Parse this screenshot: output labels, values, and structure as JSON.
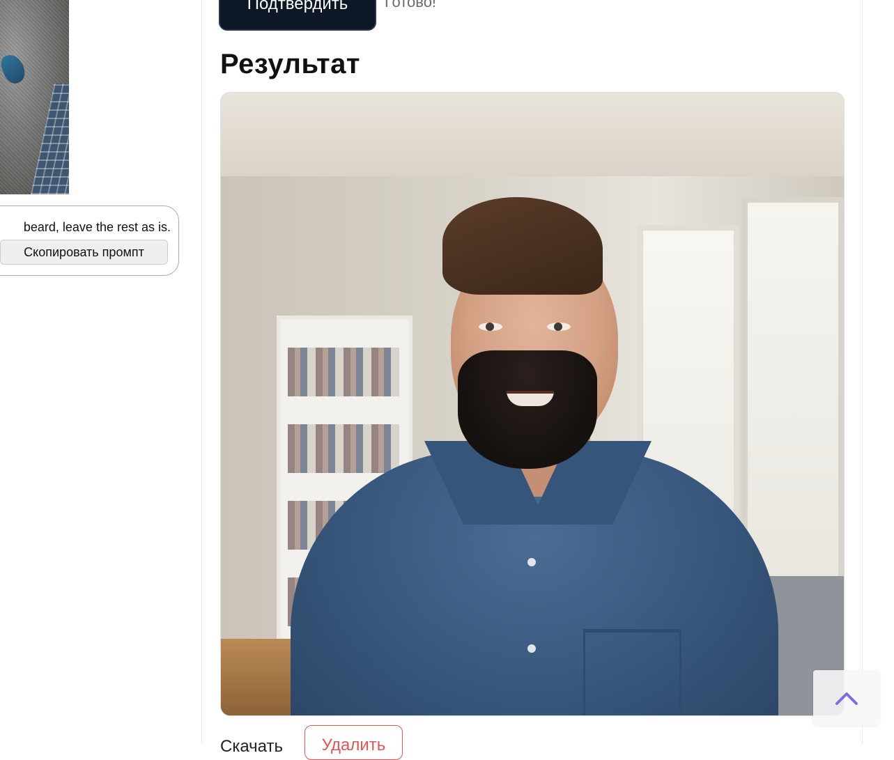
{
  "left_panel": {
    "prompt_text": "beard, leave the rest as is.",
    "copy_button_label": "Скопировать промпт"
  },
  "right_panel": {
    "confirm_button_label": "Подтвердить",
    "status_text": "Готово!",
    "result_title": "Результат",
    "download_label": "Скачать",
    "delete_button_label": "Удалить"
  },
  "icons": {
    "scroll_top": "chevron-up-icon"
  },
  "colors": {
    "primary_button": "#0e1726",
    "delete_accent": "#e05656",
    "scroll_icon": "#7b6fe0"
  }
}
